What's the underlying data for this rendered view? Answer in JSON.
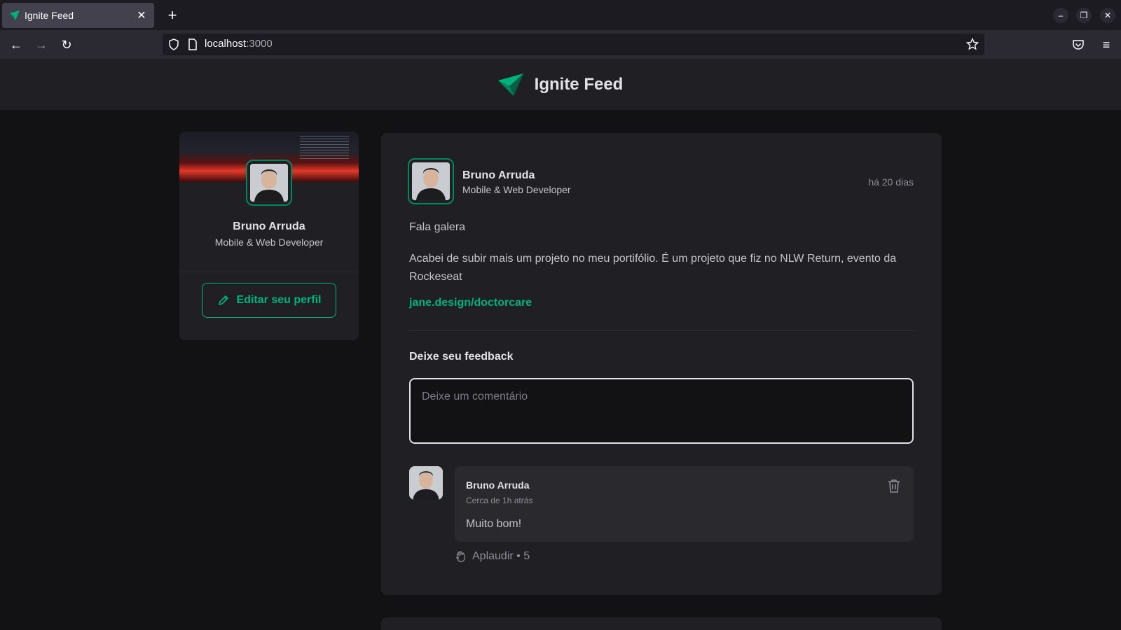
{
  "browser": {
    "tab_title": "Ignite Feed",
    "url_host": "localhost",
    "url_port": ":3000"
  },
  "header": {
    "title": "Ignite Feed"
  },
  "sidebar": {
    "name": "Bruno Arruda",
    "role": "Mobile & Web Developer",
    "edit_label": "Editar seu perfil"
  },
  "post": {
    "author_name": "Bruno Arruda",
    "author_role": "Mobile & Web Developer",
    "time": "há 20 dias",
    "paragraph_1": "Fala galera",
    "paragraph_2": "Acabei de subir mais um projeto no meu portifólio. É um projeto que fiz no NLW Return, evento da Rockeseat",
    "link": "jane.design/doctorcare",
    "feedback_title": "Deixe seu feedback",
    "comment_placeholder": "Deixe um comentário"
  },
  "comments": [
    {
      "author": "Bruno Arruda",
      "time": "Cerca de 1h atrás",
      "text": "Muito bom!",
      "applaud_label": "Aplaudir",
      "applaud_count": "5"
    }
  ],
  "colors": {
    "accent": "#00b37e",
    "accent_dark": "#00875f",
    "background": "#121214",
    "card": "#202024"
  }
}
